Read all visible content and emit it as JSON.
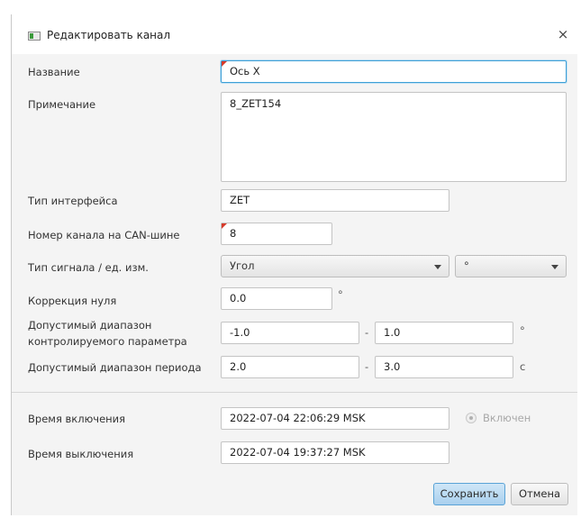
{
  "window": {
    "title": "Редактировать канал",
    "close_symbol": "×"
  },
  "fields": {
    "name": {
      "label": "Название",
      "value": "Ось X"
    },
    "note": {
      "label": "Примечание",
      "value": "8_ZET154"
    },
    "interface_type": {
      "label": "Тип интерфейса",
      "value": "ZET"
    },
    "can_channel": {
      "label": "Номер канала на CAN-шине",
      "value": "8"
    },
    "signal_type": {
      "label": "Тип сигнала / ед. изм.",
      "type_value": "Угол",
      "unit_value": "°"
    },
    "zero_correction": {
      "label": "Коррекция нуля",
      "value": "0.0",
      "unit": "°"
    },
    "param_range": {
      "label_line1": "Допустимый диапазон",
      "label_line2": "контролируемого параметра",
      "min": "-1.0",
      "max": "1.0",
      "separator": "-",
      "unit": "°"
    },
    "period_range": {
      "label": "Допустимый диапазон периода",
      "min": "2.0",
      "max": "3.0",
      "separator": "-",
      "unit": "с"
    },
    "on_time": {
      "label": "Время включения",
      "value": "2022-07-04 22:06:29 MSK"
    },
    "off_time": {
      "label": "Время выключения",
      "value": "2022-07-04 19:37:27 MSK"
    },
    "enabled": {
      "label": "Включен"
    }
  },
  "buttons": {
    "save": "Сохранить",
    "cancel": "Отмена"
  },
  "colors": {
    "focus": "#3e9fd6",
    "required_mark": "#d63a2a",
    "primary_button": "#a9d0ee"
  }
}
